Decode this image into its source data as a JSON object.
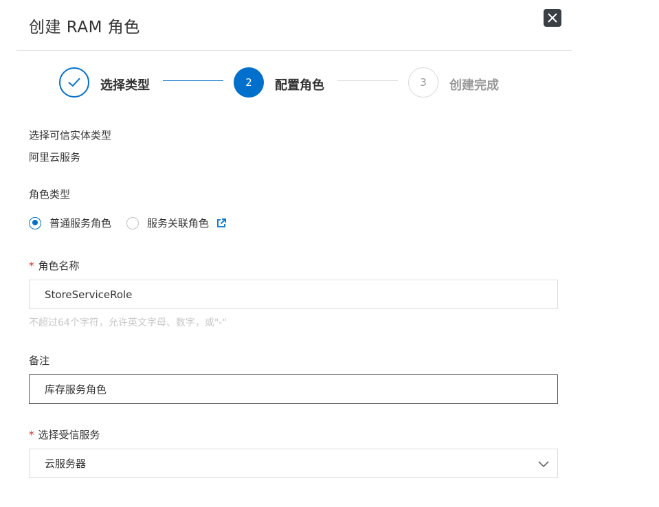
{
  "dialog": {
    "title": "创建 RAM 角色",
    "icons": {
      "close": "close-x-icon"
    }
  },
  "steps": [
    {
      "number": "1",
      "label": "选择类型",
      "status": "done"
    },
    {
      "number": "2",
      "label": "配置角色",
      "status": "active"
    },
    {
      "number": "3",
      "label": "创建完成",
      "status": "wait"
    }
  ],
  "trusted_entity": {
    "label": "选择可信实体类型",
    "value": "阿里云服务"
  },
  "role_type": {
    "label": "角色类型",
    "options": [
      {
        "label": "普通服务角色",
        "checked": true
      },
      {
        "label": "服务关联角色",
        "checked": false
      }
    ],
    "external_link_icon": "external-link-icon"
  },
  "role_name": {
    "required_mark": "*",
    "label": "角色名称",
    "value": "StoreServiceRole",
    "hint": "不超过64个字符，允许英文字母、数字，或\"-\""
  },
  "remark": {
    "label": "备注",
    "value": "库存服务角色"
  },
  "trusted_service": {
    "required_mark": "*",
    "label": "选择受信服务",
    "selected": "云服务器"
  },
  "colors": {
    "primary": "#0070cc",
    "required": "#d93026",
    "hint": "#c8c8c8"
  }
}
